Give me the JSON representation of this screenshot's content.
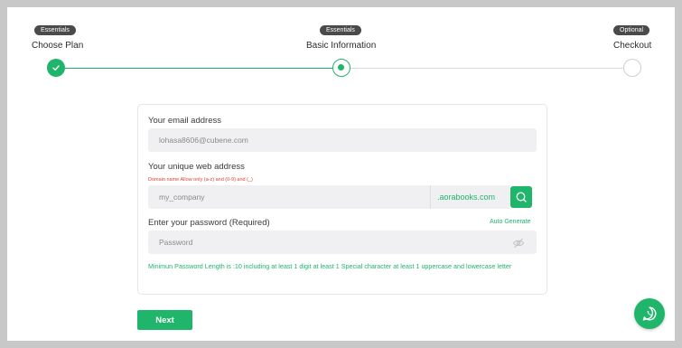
{
  "stepper": {
    "steps": [
      {
        "badge": "Essentials",
        "title": "Choose Plan",
        "state": "done"
      },
      {
        "badge": "Essentials",
        "title": "Basic Information",
        "state": "active"
      },
      {
        "badge": "Optional",
        "title": "Checkout",
        "state": "todo"
      }
    ]
  },
  "form": {
    "email": {
      "label": "Your email address",
      "value": "lohasa8606@cubene.com"
    },
    "web_address": {
      "label": "Your unique web address",
      "hint": "Domain name Allow only (a-z) and (0-9) and (_)",
      "placeholder": "my_company",
      "domain_suffix": ".aorabooks.com",
      "search_icon": "search-icon"
    },
    "password": {
      "label": "Enter your password (Required)",
      "auto_generate": "Auto Generate",
      "placeholder": "Password",
      "toggle_icon": "eye-off-icon",
      "hint": "Minimun Password Length is :10 including at least 1 digit at least 1 Special character at least 1 uppercase and lowercase letter"
    }
  },
  "actions": {
    "next_label": "Next"
  },
  "floating": {
    "icon": "whatsapp-icon"
  },
  "colors": {
    "accent": "#1fb56a",
    "badge": "#4a4a4a",
    "error": "#e0413a"
  }
}
